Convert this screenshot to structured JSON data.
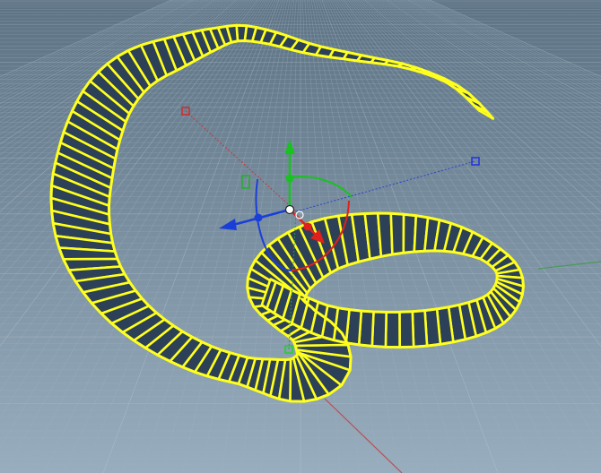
{
  "viewport": {
    "name": "3d-perspective-viewport",
    "background_top": "#5d7283",
    "background_bottom": "#98adbd",
    "grid_color": "#9db2c2",
    "grid_major_color": "#c0d0dc",
    "axis_x_color": "#c23a3a",
    "axis_y_color": "#3f9b47",
    "object_wire_color": "#ffff1f",
    "object_face_color": "#2c4057"
  },
  "object": {
    "kind": "twisted-strip-surface",
    "selected": true
  },
  "gizmo": {
    "type": "transform-gizmo",
    "x_axis_color": "#e0201c",
    "y_axis_color": "#18c21f",
    "z_axis_color": "#1a3fd8",
    "handles": [
      "move-x",
      "move-y",
      "move-z",
      "rotate-x",
      "rotate-y",
      "rotate-z",
      "scale-x",
      "scale-y",
      "scale-z",
      "pivot"
    ]
  },
  "bounding_markers": [
    "red-corner-marker",
    "blue-corner-marker",
    "green-corner-marker",
    "green-bottom-marker"
  ]
}
